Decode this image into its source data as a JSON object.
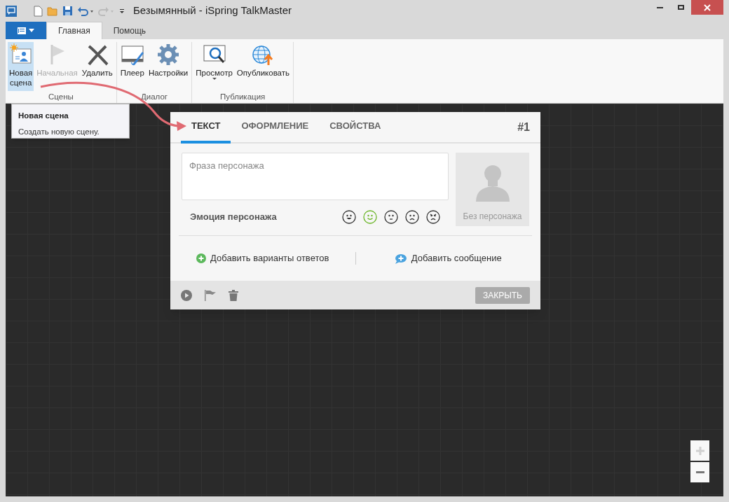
{
  "window": {
    "title": "Безымянный - iSpring TalkMaster"
  },
  "ribbon_tabs": [
    {
      "label": "Главная",
      "selected": true
    },
    {
      "label": "Помощь",
      "selected": false
    }
  ],
  "ribbon_groups": [
    {
      "label": "Сцены",
      "buttons": [
        {
          "kind": "new-scene",
          "label": "Новая сцена",
          "hovered": true,
          "disabled": false,
          "dropdown": false
        },
        {
          "kind": "flag",
          "label": "Начальная",
          "hovered": false,
          "disabled": true,
          "dropdown": false
        },
        {
          "kind": "delete",
          "label": "Удалить",
          "hovered": false,
          "disabled": false,
          "dropdown": false
        }
      ]
    },
    {
      "label": "Диалог",
      "buttons": [
        {
          "kind": "player",
          "label": "Плеер",
          "hovered": false,
          "disabled": false,
          "dropdown": false
        },
        {
          "kind": "settings",
          "label": "Настройки",
          "hovered": false,
          "disabled": false,
          "dropdown": false
        }
      ]
    },
    {
      "label": "Публикация",
      "buttons": [
        {
          "kind": "preview",
          "label": "Просмотр",
          "hovered": false,
          "disabled": false,
          "dropdown": true
        },
        {
          "kind": "publish",
          "label": "Опубликовать",
          "hovered": false,
          "disabled": false,
          "dropdown": false
        }
      ]
    }
  ],
  "tooltip": {
    "title": "Новая сцена",
    "text": "Создать новую сцену."
  },
  "dialog": {
    "tabs": [
      {
        "label": "ТЕКСТ",
        "selected": true
      },
      {
        "label": "ОФОРМЛЕНИЕ",
        "selected": false
      },
      {
        "label": "СВОЙСТВА",
        "selected": false
      }
    ],
    "number": "#1",
    "phrase": {
      "placeholder": "Фраза персонажа"
    },
    "emotion_label": "Эмоция персонажа",
    "emotions": [
      {
        "kind": "laugh",
        "selected": false
      },
      {
        "kind": "smile",
        "selected": true
      },
      {
        "kind": "neutral",
        "selected": false
      },
      {
        "kind": "sad",
        "selected": false
      },
      {
        "kind": "angry",
        "selected": false
      }
    ],
    "character": {
      "label": "Без персонажа"
    },
    "actions": [
      {
        "kind": "answers",
        "label": "Добавить варианты ответов"
      },
      {
        "kind": "message",
        "label": "Добавить сообщение"
      }
    ],
    "close_button": "ЗАКРЫТЬ"
  }
}
